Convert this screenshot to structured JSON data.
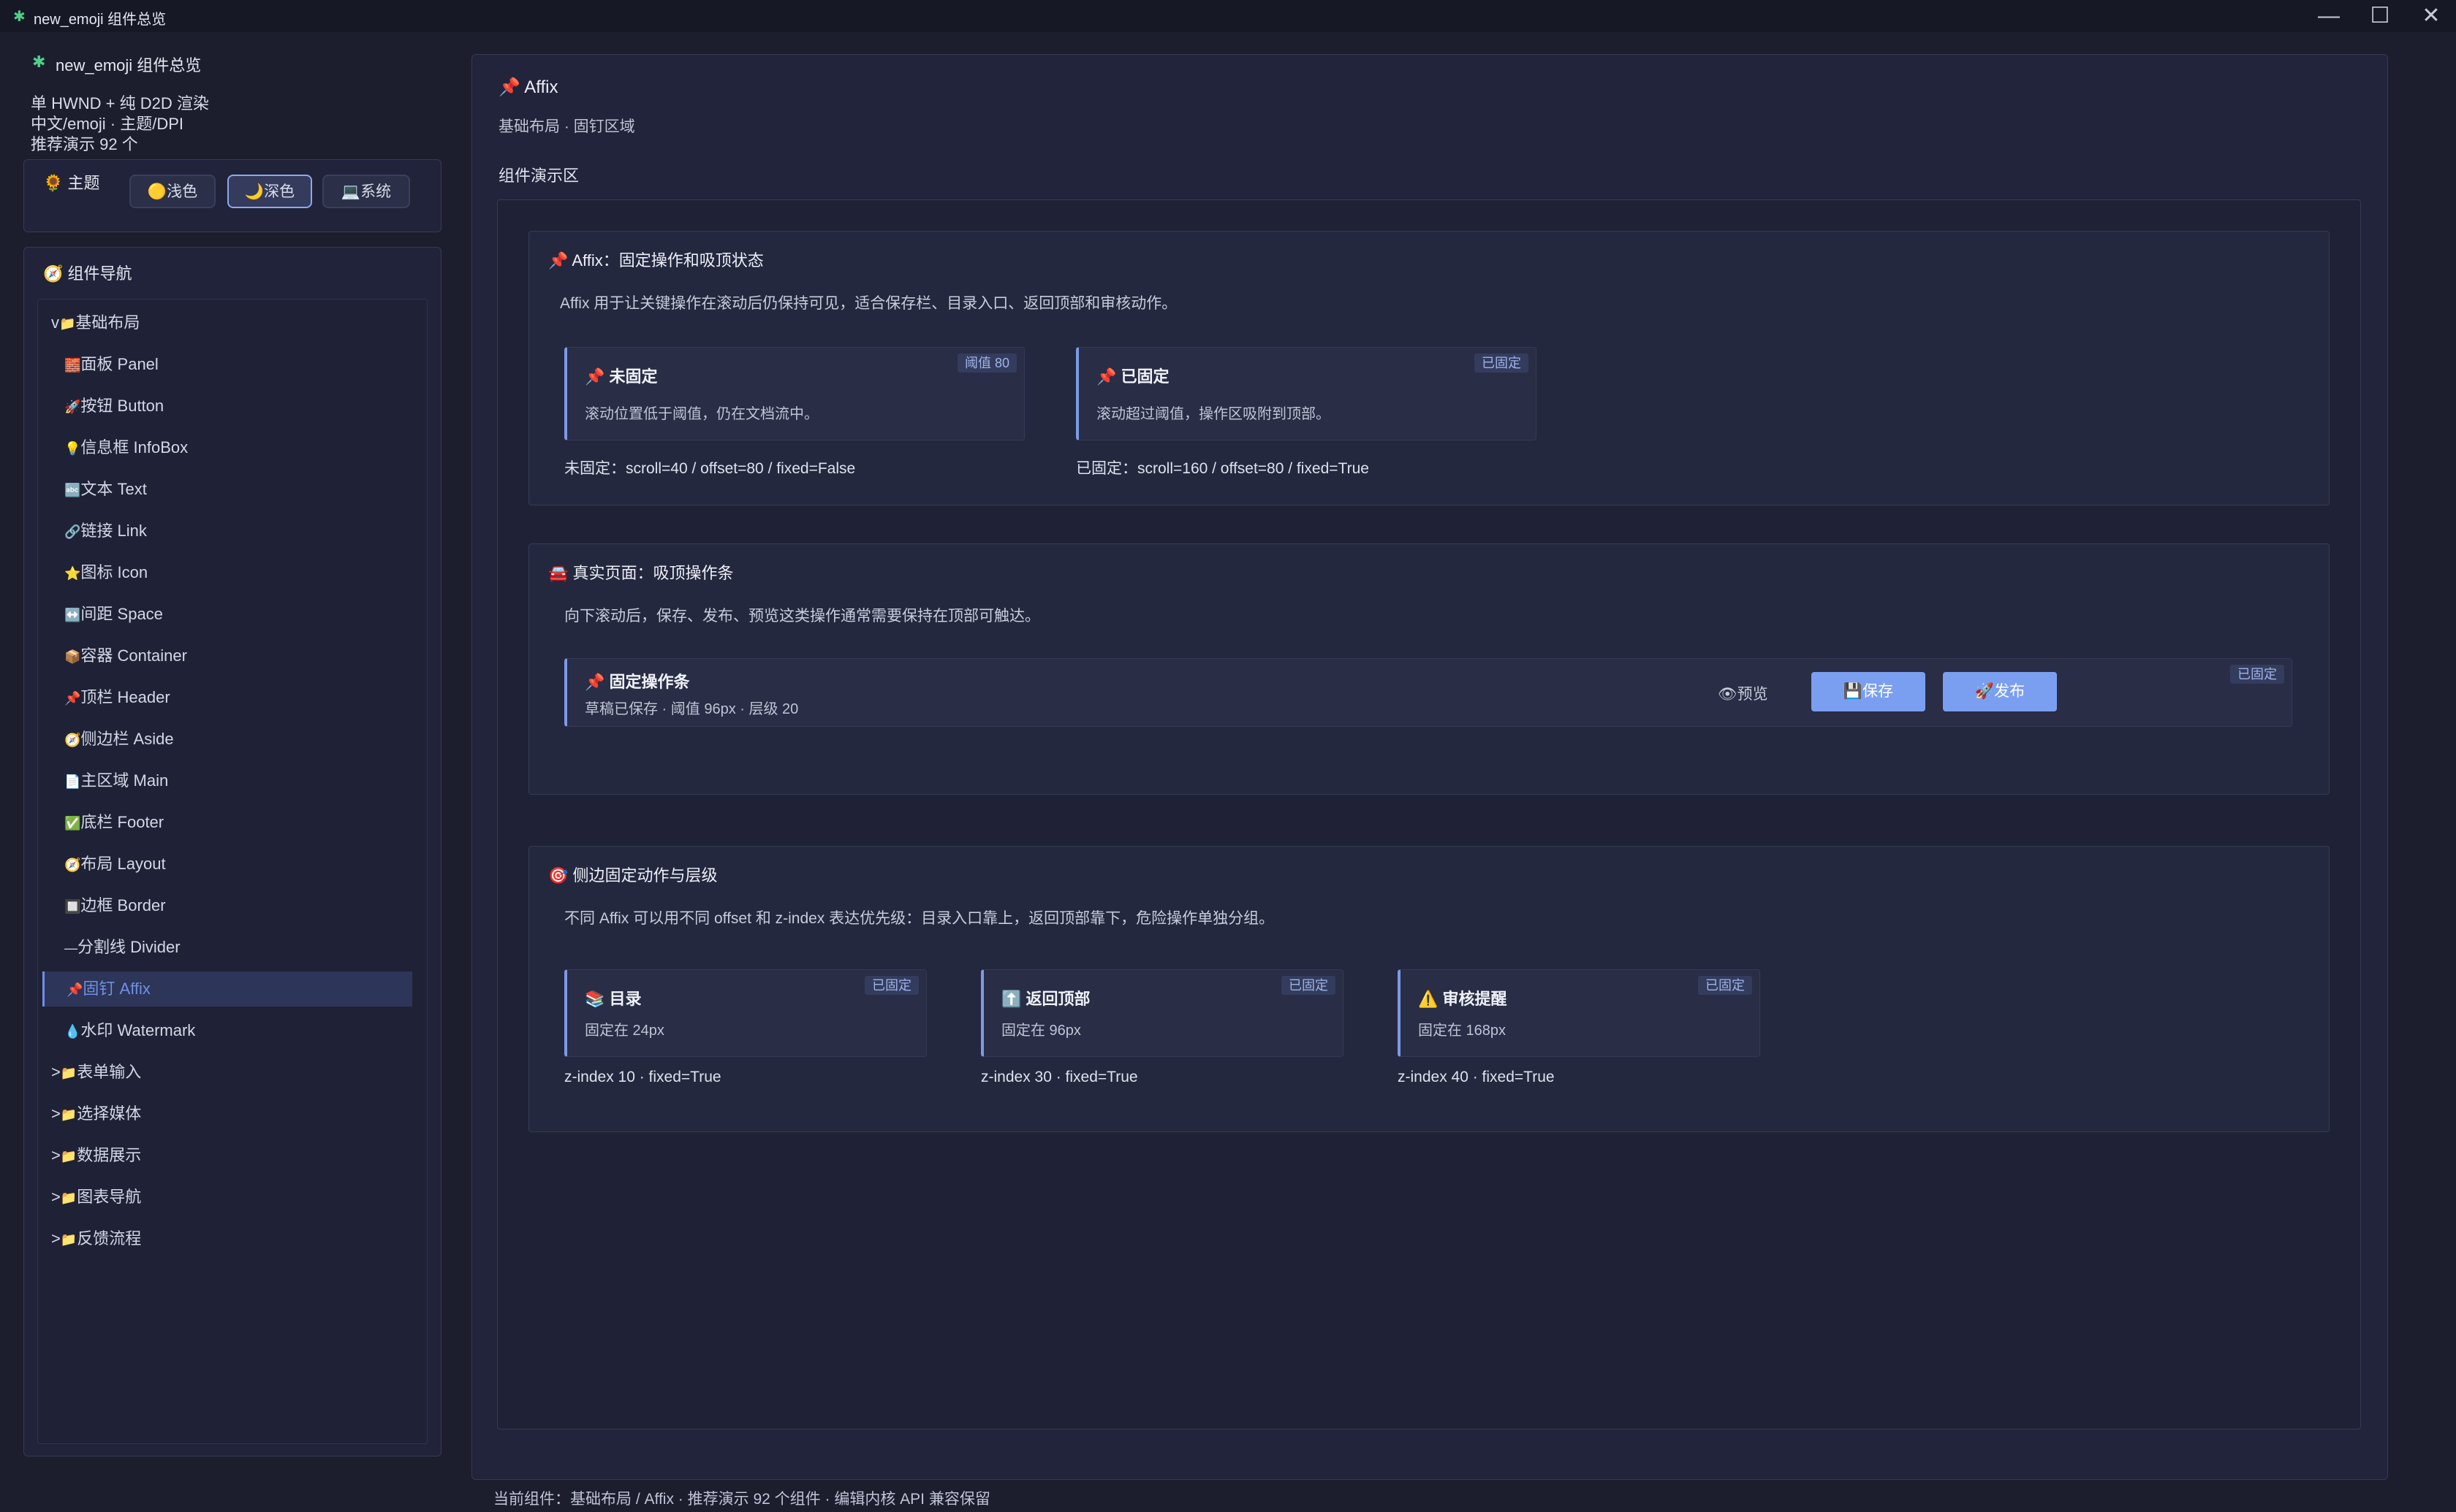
{
  "window": {
    "title": "new_emoji 组件总览",
    "icon": "puzzle-icon",
    "controls": [
      "—",
      "☐",
      "✕"
    ]
  },
  "sidebar": {
    "app_title": "new_emoji 组件总览",
    "info": [
      "单 HWND + 纯 D2D 渲染",
      "中文/emoji · 主题/DPI",
      "推荐演示 92 个"
    ],
    "theme": {
      "label": "主题",
      "icon": "🌻",
      "buttons": [
        {
          "icon": "🟡",
          "label": "浅色",
          "active": false
        },
        {
          "icon": "🌙",
          "label": "深色",
          "active": true
        },
        {
          "icon": "💻",
          "label": "系统",
          "active": false
        }
      ]
    },
    "nav": {
      "title": "组件导航",
      "icon": "🧭",
      "items": [
        {
          "arrow": "v",
          "icon": "📁",
          "label": "基础布局",
          "level": 0
        },
        {
          "icon": "🧱",
          "label": "面板 Panel",
          "level": 1
        },
        {
          "icon": "🚀",
          "label": "按钮 Button",
          "level": 1
        },
        {
          "icon": "💡",
          "label": "信息框 InfoBox",
          "level": 1
        },
        {
          "icon": "🔤",
          "label": "文本 Text",
          "level": 1
        },
        {
          "icon": "🔗",
          "label": "链接 Link",
          "level": 1
        },
        {
          "icon": "⭐",
          "label": "图标 Icon",
          "level": 1
        },
        {
          "icon": "↔️",
          "label": "间距 Space",
          "level": 1
        },
        {
          "icon": "📦",
          "label": "容器 Container",
          "level": 1
        },
        {
          "icon": "📌",
          "label": "顶栏 Header",
          "level": 1
        },
        {
          "icon": "🧭",
          "label": "侧边栏 Aside",
          "level": 1
        },
        {
          "icon": "📄",
          "label": "主区域 Main",
          "level": 1
        },
        {
          "icon": "✅",
          "label": "底栏 Footer",
          "level": 1
        },
        {
          "icon": "🧭",
          "label": "布局 Layout",
          "level": 1
        },
        {
          "icon": "🔲",
          "label": "边框 Border",
          "level": 1
        },
        {
          "icon": "—",
          "label": "分割线 Divider",
          "level": 1
        },
        {
          "icon": "📌",
          "label": "固钉 Affix",
          "level": 1,
          "active": true
        },
        {
          "icon": "💧",
          "label": "水印 Watermark",
          "level": 1
        },
        {
          "arrow": ">",
          "icon": "📁",
          "label": "表单输入",
          "level": 0
        },
        {
          "arrow": ">",
          "icon": "📁",
          "label": "选择媒体",
          "level": 0
        },
        {
          "arrow": ">",
          "icon": "📁",
          "label": "数据展示",
          "level": 0
        },
        {
          "arrow": ">",
          "icon": "📁",
          "label": "图表导航",
          "level": 0
        },
        {
          "arrow": ">",
          "icon": "📁",
          "label": "反馈流程",
          "level": 0
        }
      ]
    }
  },
  "main": {
    "title": "Affix",
    "title_icon": "📌",
    "subtitle": "基础布局 · 固钉区域",
    "demo_label": "组件演示区",
    "sections": [
      {
        "icon": "📌",
        "title": "Affix：固定操作和吸顶状态",
        "desc": "Affix 用于让关键操作在滚动后仍保持可见，适合保存栏、目录入口、返回顶部和审核动作。",
        "cards": [
          {
            "icon": "📌",
            "title": "未固定",
            "desc": "滚动位置低于阈值，仍在文档流中。",
            "badge": "阈值 80",
            "caption": "未固定：scroll=40 / offset=80 / fixed=False"
          },
          {
            "icon": "📌",
            "title": "已固定",
            "desc": "滚动超过阈值，操作区吸附到顶部。",
            "badge": "已固定",
            "caption": "已固定：scroll=160 / offset=80 / fixed=True"
          }
        ]
      },
      {
        "icon": "🚘",
        "title": "真实页面：吸顶操作条",
        "desc": "向下滚动后，保存、发布、预览这类操作通常需要保持在顶部可触达。",
        "bar": {
          "icon": "📌",
          "title": "固定操作条",
          "desc": "草稿已保存 · 阈值 96px · 层级 20",
          "badge": "已固定",
          "preview": {
            "icon": "👁",
            "label": "预览"
          },
          "save": {
            "icon": "💾",
            "label": "保存"
          },
          "publish": {
            "icon": "🚀",
            "label": "发布"
          }
        }
      },
      {
        "icon": "🎯",
        "title": "侧边固定动作与层级",
        "desc": "不同 Affix 可以用不同 offset 和 z-index 表达优先级：目录入口靠上，返回顶部靠下，危险操作单独分组。",
        "cards": [
          {
            "icon": "📚",
            "title": "目录",
            "desc": "固定在 24px",
            "badge": "已固定",
            "caption": "z-index 10 · fixed=True"
          },
          {
            "icon": "⬆️",
            "title": "返回顶部",
            "desc": "固定在 96px",
            "badge": "已固定",
            "caption": "z-index 30 · fixed=True"
          },
          {
            "icon": "⚠️",
            "title": "审核提醒",
            "desc": "固定在 168px",
            "badge": "已固定",
            "caption": "z-index 40 · fixed=True"
          }
        ]
      }
    ]
  },
  "status_bar": "当前组件：基础布局 / Affix · 推荐演示 92 个组件 · 编辑内核 API 兼容保留"
}
